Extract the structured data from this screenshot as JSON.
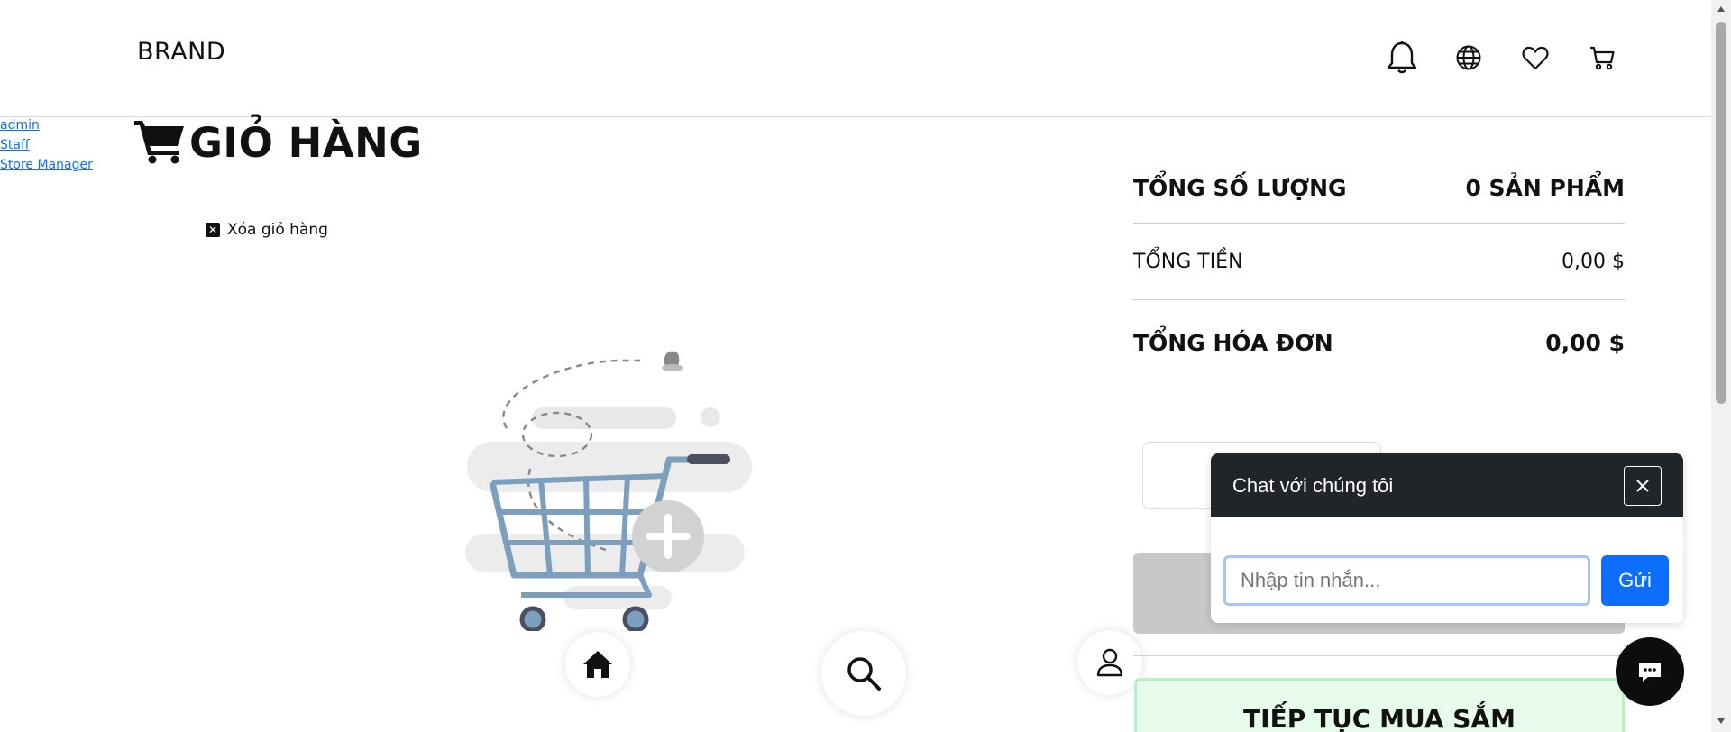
{
  "header": {
    "brand": "BRAND",
    "icons": [
      "bell-icon",
      "globe-icon",
      "heart-icon",
      "cart-icon"
    ]
  },
  "roles": [
    "admin",
    "Staff",
    "Store Manager"
  ],
  "cart": {
    "title": "GIỎ HÀNG",
    "clear_label": "Xóa giỏ hàng"
  },
  "summary": {
    "qty_label": "TỔNG SỐ LƯỢNG",
    "qty_value": "0 SẢN PHẨM",
    "total_label": "TỔNG TIỀN",
    "total_value": "0,00 $",
    "invoice_label": "TỔNG HÓA ĐƠN",
    "invoice_value": "0,00 $",
    "continue_label": "TIẾP TỤC MUA SẮM"
  },
  "chat": {
    "title": "Chat với chúng tôi",
    "placeholder": "Nhập tin nhắn...",
    "send_label": "Gửi"
  },
  "colors": {
    "primary": "#0d6efd",
    "chat_header": "#212529",
    "continue_bg": "#e6fbe9"
  }
}
